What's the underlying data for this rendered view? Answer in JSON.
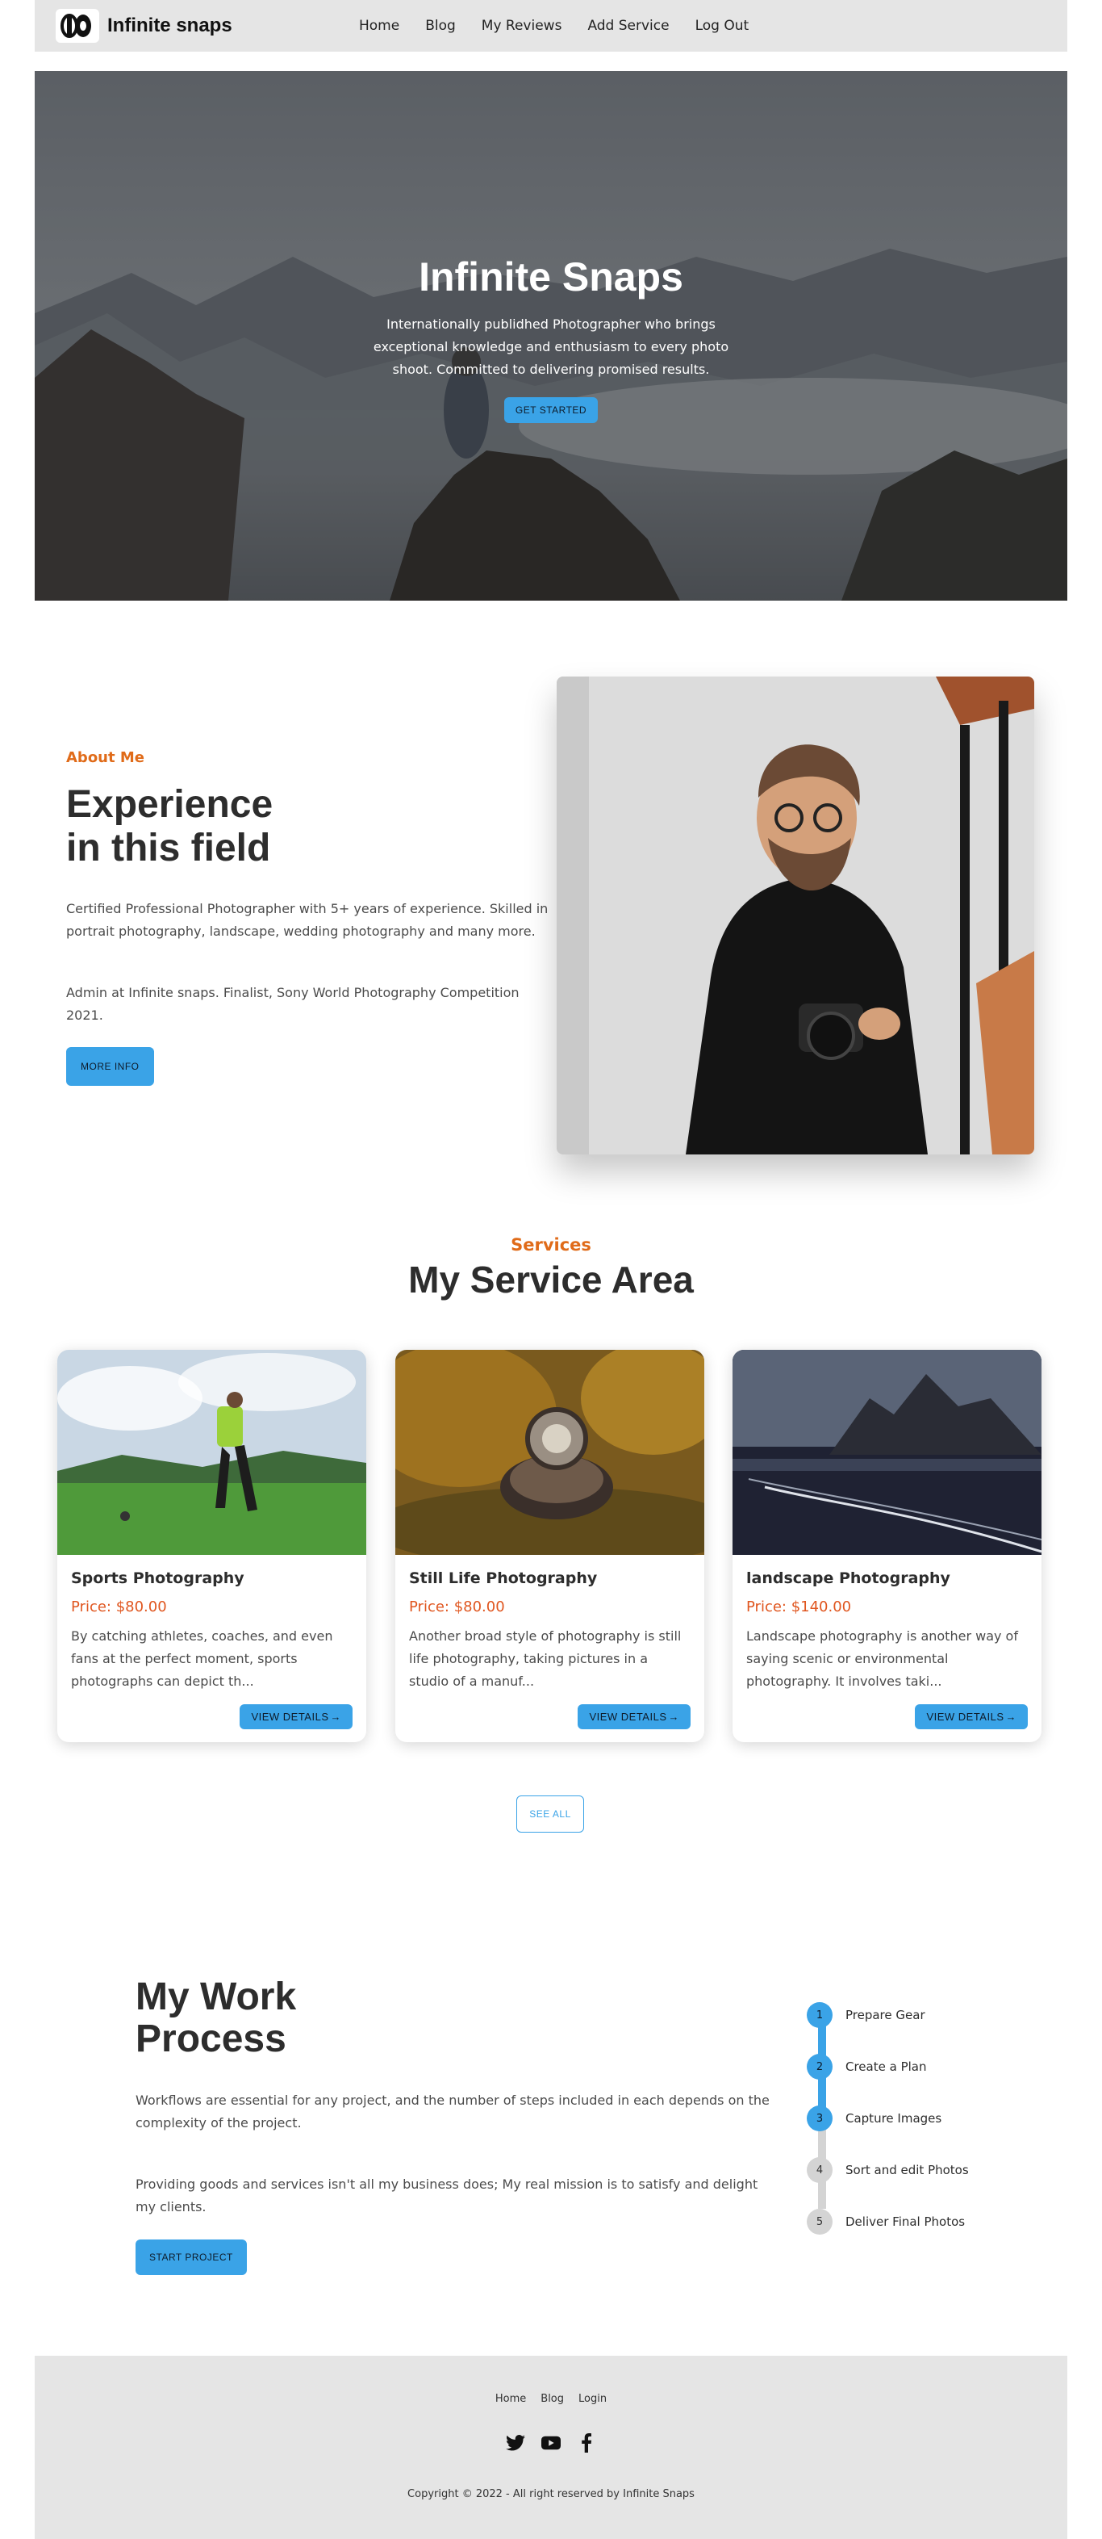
{
  "nav": {
    "brand": "Infinite snaps",
    "links": [
      "Home",
      "Blog",
      "My Reviews",
      "Add Service",
      "Log Out"
    ]
  },
  "hero": {
    "title": "Infinite Snaps",
    "description": "Internationally publidhed Photographer who brings exceptional knowledge and enthusiasm to every photo shoot. Committed to delivering promised results.",
    "button": "GET STARTED"
  },
  "about": {
    "label": "About Me",
    "title_line1": "Experience",
    "title_line2": "in this field",
    "paragraph1": "Certified Professional Photographer with 5+ years of experience. Skilled in portrait photography, landscape, wedding photography and many more.",
    "paragraph2": "Admin at Infinite snaps. Finalist, Sony World Photography Competition 2021.",
    "button": "MORE INFO"
  },
  "services": {
    "label": "Services",
    "title": "My Service Area",
    "cards": [
      {
        "title": "Sports Photography",
        "price": "Price: $80.00",
        "description": "By catching athletes, coaches, and even fans at the perfect moment, sports photographs can depict th...",
        "button": "VIEW DETAILS"
      },
      {
        "title": "Still Life Photography",
        "price": "Price: $80.00",
        "description": "Another broad style of photography is still life photography, taking pictures in a studio of a manuf...",
        "button": "VIEW DETAILS"
      },
      {
        "title": "landscape Photography",
        "price": "Price: $140.00",
        "description": "Landscape photography is another way of saying scenic or environmental photography. It involves taki...",
        "button": "VIEW DETAILS"
      }
    ],
    "see_all": "SEE ALL"
  },
  "process": {
    "title_line1": "My Work",
    "title_line2": "Process",
    "paragraph1": "Workflows are essential for any project, and the number of steps included in each depends on the complexity of the project.",
    "paragraph2": "Providing goods and services isn't all my business does; My real mission is to satisfy and delight my clients.",
    "button": "START PROJECT",
    "steps": [
      {
        "num": "1",
        "label": "Prepare Gear",
        "done": true
      },
      {
        "num": "2",
        "label": "Create a Plan",
        "done": true
      },
      {
        "num": "3",
        "label": "Capture Images",
        "done": true
      },
      {
        "num": "4",
        "label": "Sort and edit Photos",
        "done": false
      },
      {
        "num": "5",
        "label": "Deliver Final Photos",
        "done": false
      }
    ]
  },
  "footer": {
    "links": [
      "Home",
      "Blog",
      "Login"
    ],
    "social": [
      "twitter-icon",
      "youtube-icon",
      "facebook-icon"
    ],
    "copyright": "Copyright © 2022 - All right reserved by Infinite Snaps"
  },
  "colors": {
    "accent": "#3aa3e7",
    "orange": "#e06b19",
    "price": "#e0561f",
    "navbar_bg": "#e5e5e5"
  }
}
